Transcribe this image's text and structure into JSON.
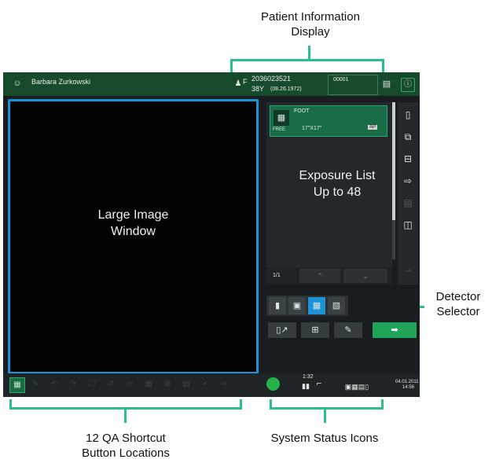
{
  "callouts": {
    "patient_info_line1": "Patient Information",
    "patient_info_line2": "Display",
    "detector_line1": "Detector",
    "detector_line2": "Selector",
    "qa_line1": "12 QA Shortcut",
    "qa_line2": "Button Locations",
    "status": "System Status Icons"
  },
  "topbar": {
    "patient_name": "Barbara Zurkowski",
    "patient_id": "2036023521",
    "age": "38Y",
    "dob": "(08.26.1972)",
    "accession": "00001",
    "sex": "F"
  },
  "image_window": {
    "line1": "Large Image",
    "line2": "Window"
  },
  "exposure": {
    "item_label": "FOOT",
    "free_label": "FREE",
    "size": "17\"X17\"",
    "af": "AP",
    "overlay_line1": "Exposure List",
    "overlay_line2": "Up to 48",
    "page": "1/1"
  },
  "status": {
    "count": "1:32",
    "date": "04.01.2011",
    "time": "14:56"
  },
  "icons": {
    "user": "user-icon",
    "patient_sex": "person-icon",
    "patient_card": "patient-card-icon",
    "info": "info-icon"
  },
  "colors": {
    "topbar": "#174a2c",
    "image_window_border": "#1c93d6",
    "callout_lines": "#2bbf8c",
    "expose_button": "#21a45a",
    "status_led": "#27b14a"
  }
}
